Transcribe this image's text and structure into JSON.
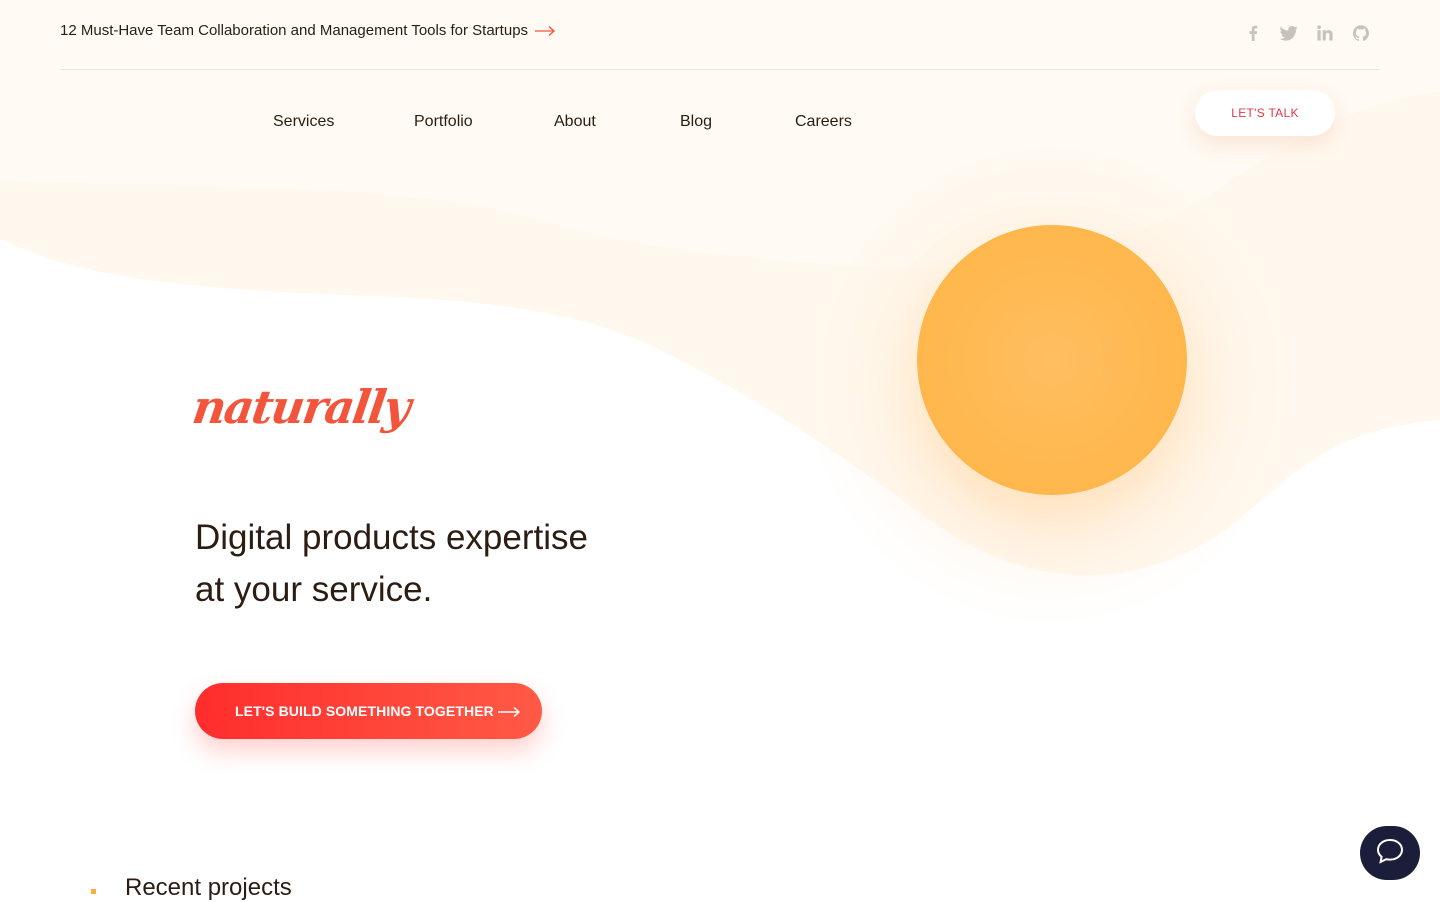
{
  "announcement": {
    "text": "12 Must-Have Team Collaboration and Management Tools for Startups",
    "icon": "arrow-right-icon"
  },
  "socials": [
    {
      "name": "facebook",
      "icon": "facebook-icon"
    },
    {
      "name": "twitter",
      "icon": "twitter-icon"
    },
    {
      "name": "linkedin",
      "icon": "linkedin-icon"
    },
    {
      "name": "github",
      "icon": "github-icon"
    }
  ],
  "nav": {
    "items": [
      "Services",
      "Portfolio",
      "About",
      "Blog",
      "Careers"
    ]
  },
  "header": {
    "cta_label": "LET'S TALK"
  },
  "hero": {
    "logo_text": "naturally",
    "headline_line1": "Digital products expertise",
    "headline_line2": "at your service.",
    "cta_label": "LET'S BUILD SOMETHING TOGETHER"
  },
  "section": {
    "title": "Recent projects"
  },
  "colors": {
    "accent_red": "#ff3b30",
    "logo": "#f2543c",
    "sun": "#ffb84f",
    "chat_bg": "#1b1e3a",
    "text": "#2b1d12"
  }
}
